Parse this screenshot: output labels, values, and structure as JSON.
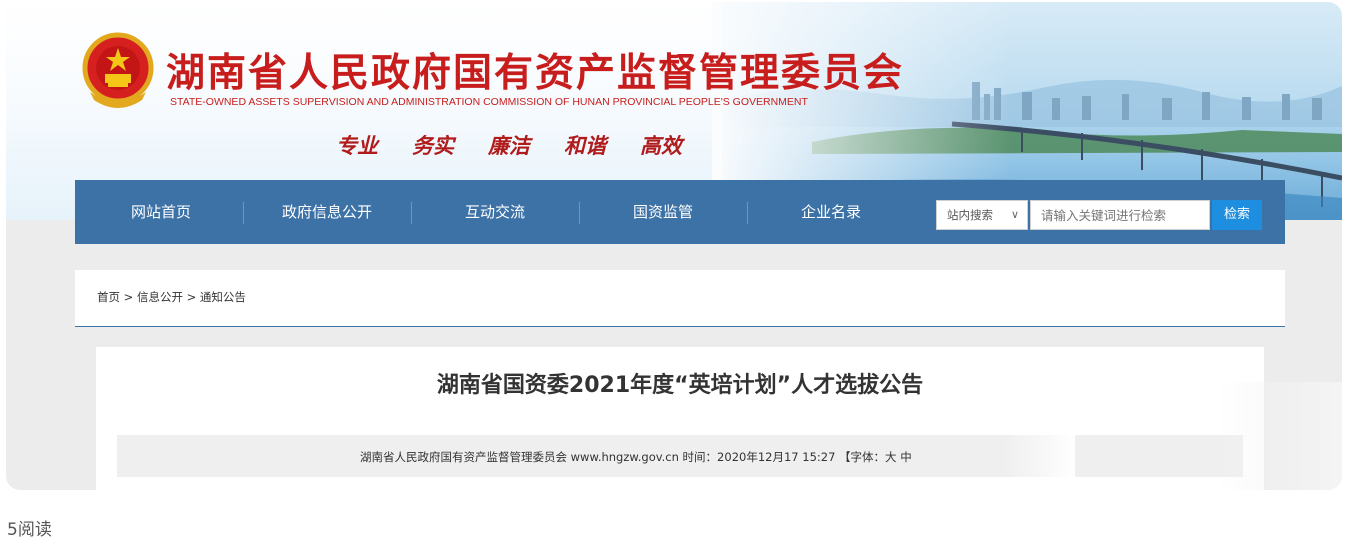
{
  "header": {
    "title_cn": "湖南省人民政府国有资产监督管理委员会",
    "title_en": "STATE-OWNED ASSETS SUPERVISION AND ADMINISTRATION COMMISSION OF HUNAN PROVINCIAL PEOPLE'S GOVERNMENT",
    "slogans": [
      "专业",
      "务实",
      "廉洁",
      "和谐",
      "高效"
    ],
    "emblem_icon": "national-emblem-icon"
  },
  "nav": {
    "items": [
      {
        "label": "网站首页"
      },
      {
        "label": "政府信息公开"
      },
      {
        "label": "互动交流"
      },
      {
        "label": "国资监管"
      },
      {
        "label": "企业名录"
      }
    ],
    "search": {
      "scope_value": "站内搜索",
      "scope_icon": "chevron-down-icon",
      "placeholder": "请输入关键词进行检索",
      "button_label": "检索"
    }
  },
  "breadcrumb": "首页 > 信息公开 > 通知公告",
  "article": {
    "title": "湖南省国资委2021年度“英培计划”人才选拔公告",
    "meta": "湖南省人民政府国有资产监督管理委员会 www.hngzw.gov.cn   时间：2020年12月17 15:27   【字体：大 中"
  },
  "footer": {
    "reads": "5阅读"
  },
  "colors": {
    "nav_bg": "#3d72a7",
    "title_red": "#c81d1d",
    "search_button": "#1e8fe0"
  }
}
